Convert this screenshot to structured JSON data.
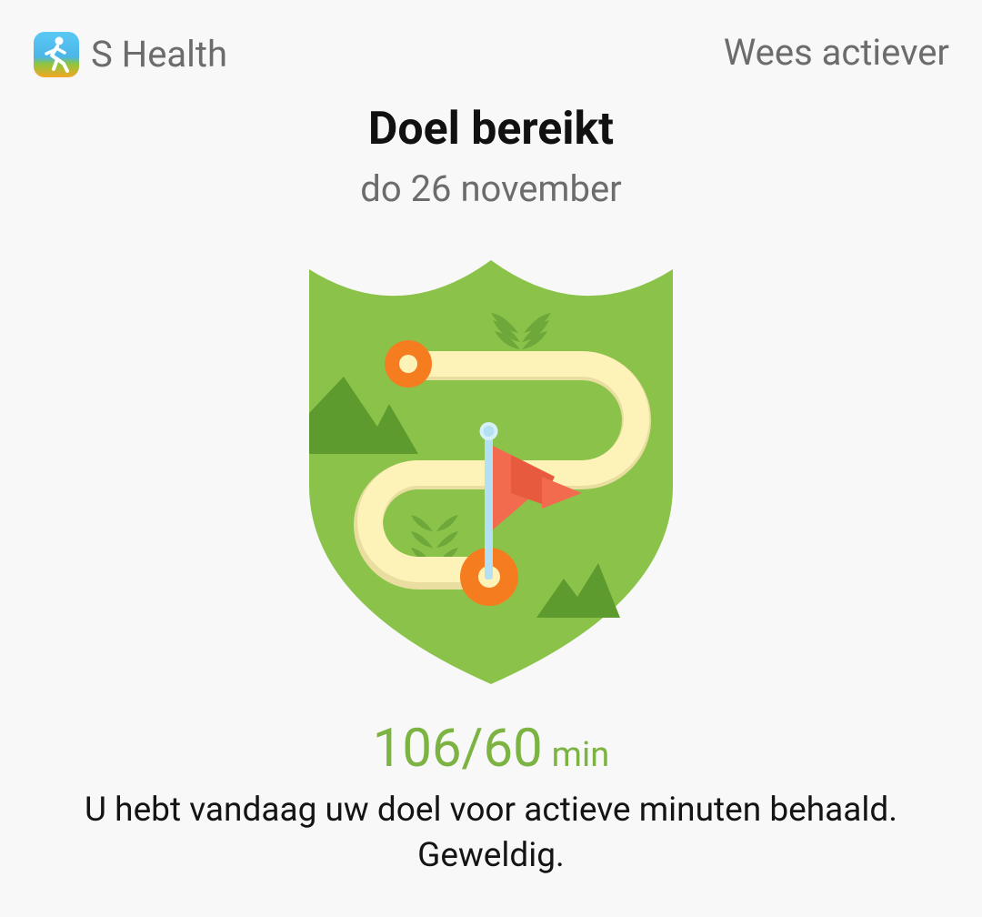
{
  "header": {
    "app_name": "S Health",
    "app_icon": "running-person-app-icon",
    "category": "Wees actiever"
  },
  "main": {
    "title": "Doel bereikt",
    "date": "do 26 november",
    "badge_icon": "goal-achieved-shield-badge-icon",
    "goal": {
      "achieved_minutes": 106,
      "target_minutes": 60,
      "value_text": "106/60",
      "unit": "min"
    },
    "message_line1": "U hebt vandaag uw doel voor actieve minuten behaald.",
    "message_line2": "Geweldig."
  },
  "colors": {
    "accent_green": "#7cb342",
    "shield_green": "#8bc34a",
    "mountain_green": "#5d9b2f",
    "path_cream": "#fdf3b8",
    "marker_orange": "#f57c1f",
    "flag_red": "#f26b4f",
    "pole_blue": "#b3e0f2",
    "text_gray": "#6c6c6c",
    "text_dark": "#141414"
  }
}
